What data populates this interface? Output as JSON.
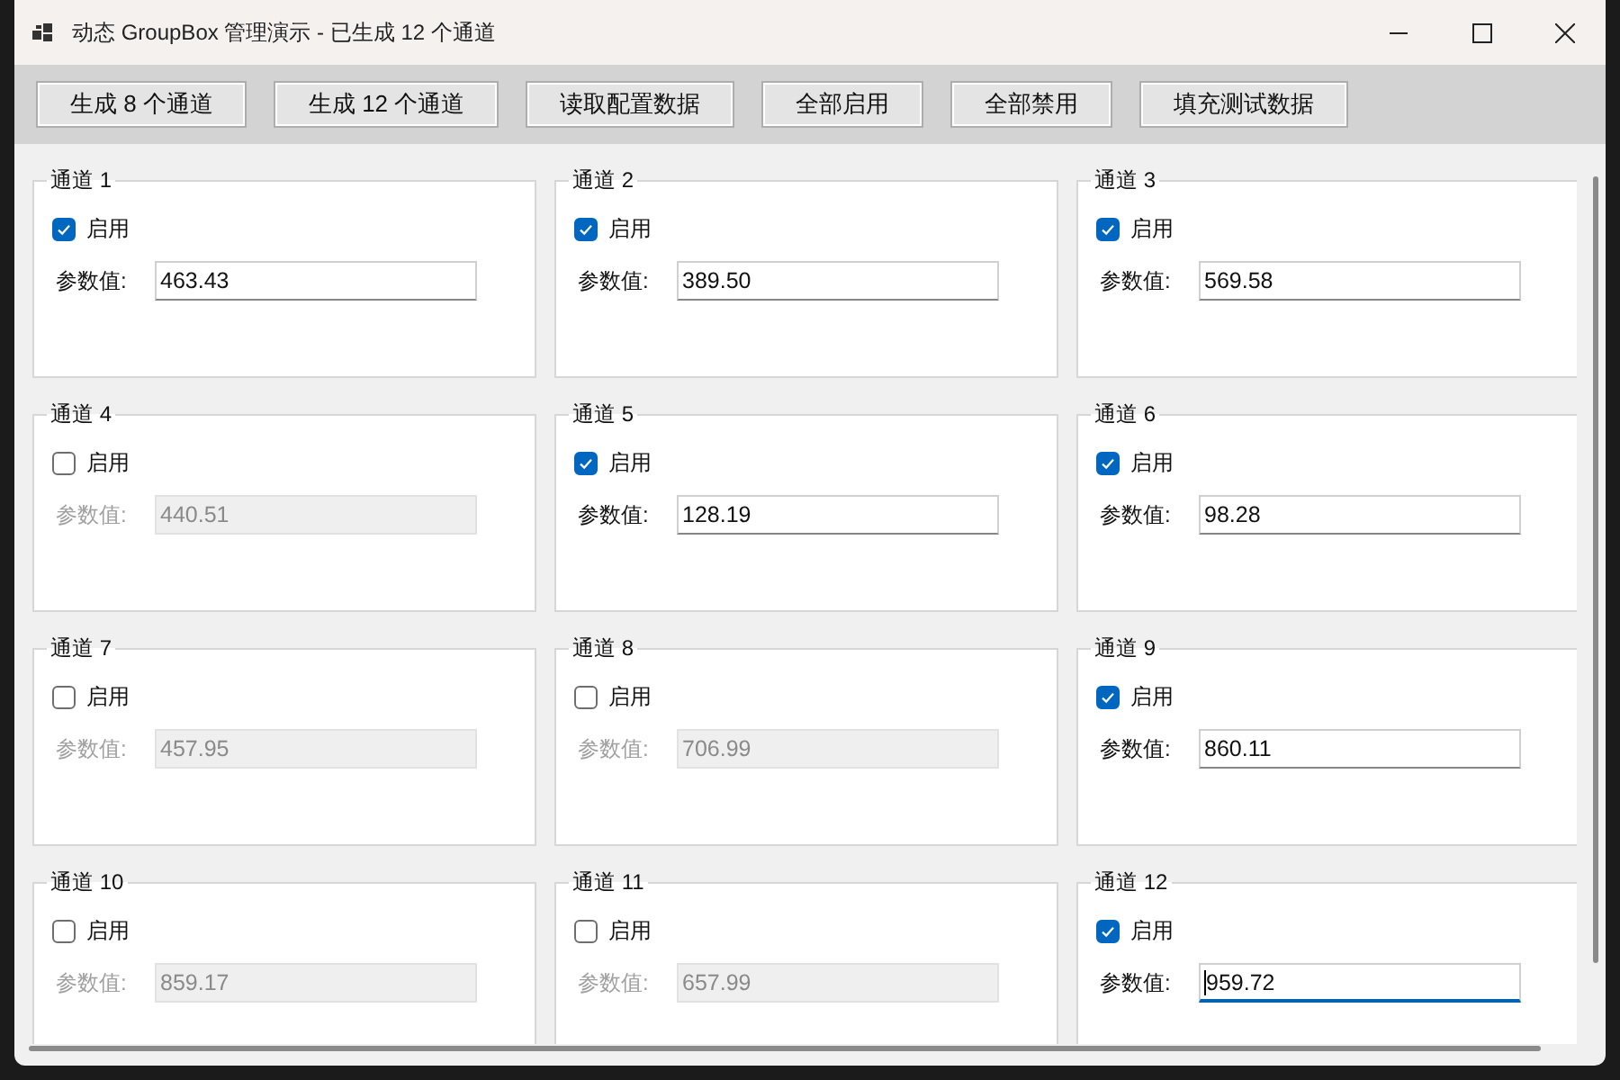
{
  "window": {
    "title": "动态 GroupBox 管理演示 - 已生成 12 个通道"
  },
  "toolbar": [
    "生成 8 个通道",
    "生成 12 个通道",
    "读取配置数据",
    "全部启用",
    "全部禁用",
    "填充测试数据"
  ],
  "channels": [
    {
      "title": "通道 1",
      "checkbox_label": "启用",
      "checked": true,
      "field_label": "参数值:",
      "value": "463.43",
      "focused": false
    },
    {
      "title": "通道 2",
      "checkbox_label": "启用",
      "checked": true,
      "field_label": "参数值:",
      "value": "389.50",
      "focused": false
    },
    {
      "title": "通道 3",
      "checkbox_label": "启用",
      "checked": true,
      "field_label": "参数值:",
      "value": "569.58",
      "focused": false
    },
    {
      "title": "通道 4",
      "checkbox_label": "启用",
      "checked": false,
      "field_label": "参数值:",
      "value": "440.51",
      "focused": false
    },
    {
      "title": "通道 5",
      "checkbox_label": "启用",
      "checked": true,
      "field_label": "参数值:",
      "value": "128.19",
      "focused": false
    },
    {
      "title": "通道 6",
      "checkbox_label": "启用",
      "checked": true,
      "field_label": "参数值:",
      "value": "98.28",
      "focused": false
    },
    {
      "title": "通道 7",
      "checkbox_label": "启用",
      "checked": false,
      "field_label": "参数值:",
      "value": "457.95",
      "focused": false
    },
    {
      "title": "通道 8",
      "checkbox_label": "启用",
      "checked": false,
      "field_label": "参数值:",
      "value": "706.99",
      "focused": false
    },
    {
      "title": "通道 9",
      "checkbox_label": "启用",
      "checked": true,
      "field_label": "参数值:",
      "value": "860.11",
      "focused": false
    },
    {
      "title": "通道 10",
      "checkbox_label": "启用",
      "checked": false,
      "field_label": "参数值:",
      "value": "859.17",
      "focused": false
    },
    {
      "title": "通道 11",
      "checkbox_label": "启用",
      "checked": false,
      "field_label": "参数值:",
      "value": "657.99",
      "focused": false
    },
    {
      "title": "通道 12",
      "checkbox_label": "启用",
      "checked": true,
      "field_label": "参数值:",
      "value": "959.72",
      "focused": true
    }
  ]
}
